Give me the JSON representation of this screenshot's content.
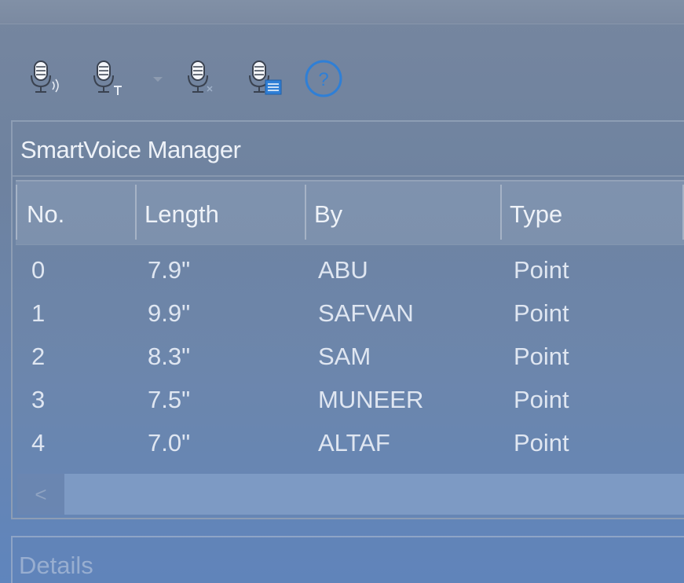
{
  "toolbar": {
    "icons": [
      {
        "name": "mic-record-icon"
      },
      {
        "name": "mic-text-icon"
      },
      {
        "name": "dropdown-arrow-icon"
      },
      {
        "name": "mic-delete-icon"
      },
      {
        "name": "mic-list-icon"
      },
      {
        "name": "help-icon",
        "glyph": "?"
      }
    ]
  },
  "panel": {
    "title": "SmartVoice Manager",
    "columns": [
      "No.",
      "Length",
      "By",
      "Type"
    ],
    "rows": [
      {
        "no": "0",
        "length": "7.9\"",
        "by": "ABU",
        "type": "Point"
      },
      {
        "no": "1",
        "length": "9.9\"",
        "by": "SAFVAN",
        "type": "Point"
      },
      {
        "no": "2",
        "length": "8.3\"",
        "by": "SAM",
        "type": "Point"
      },
      {
        "no": "3",
        "length": "7.5\"",
        "by": "MUNEER",
        "type": "Point"
      },
      {
        "no": "4",
        "length": "7.0\"",
        "by": "ALTAF",
        "type": "Point"
      }
    ],
    "scroll_left_glyph": "<"
  },
  "details": {
    "title": "Details"
  },
  "colors": {
    "background": "#6a85ae",
    "header": "#7f92ae",
    "accent_blue": "#2f7fd6"
  }
}
